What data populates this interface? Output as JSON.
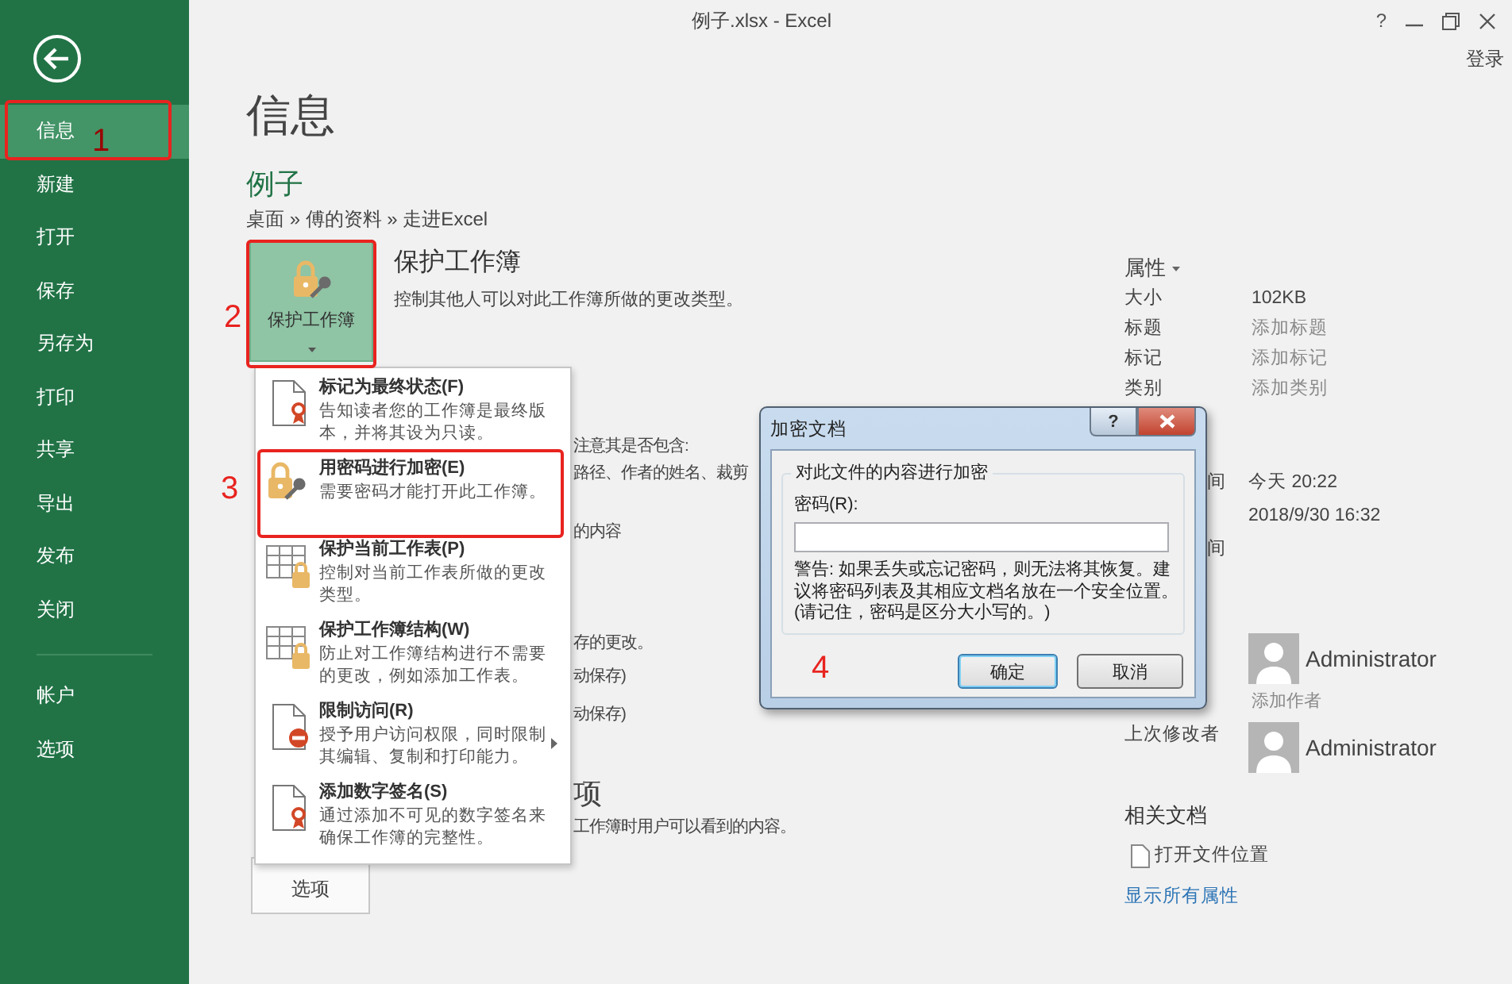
{
  "window": {
    "title": "例子.xlsx - Excel",
    "help": "?",
    "sign_in": "登录"
  },
  "sidebar": {
    "items": [
      {
        "label": "信息",
        "selected": true
      },
      {
        "label": "新建",
        "selected": false
      },
      {
        "label": "打开",
        "selected": false
      },
      {
        "label": "保存",
        "selected": false
      },
      {
        "label": "另存为",
        "selected": false
      },
      {
        "label": "打印",
        "selected": false
      },
      {
        "label": "共享",
        "selected": false
      },
      {
        "label": "导出",
        "selected": false
      },
      {
        "label": "发布",
        "selected": false
      },
      {
        "label": "关闭",
        "selected": false
      }
    ],
    "footer_items": [
      {
        "label": "帐户",
        "selected": false
      },
      {
        "label": "选项",
        "selected": false
      }
    ]
  },
  "page": {
    "heading": "信息",
    "file_name": "例子",
    "path": "桌面 » 傅的资料 » 走进Excel"
  },
  "protect": {
    "button_label": "保护工作簿",
    "title": "保护工作簿",
    "description": "控制其他人可以对此工作簿所做的更改类型。"
  },
  "background_fragments": [
    {
      "kind": "text",
      "text": "注意其是否包含:"
    },
    {
      "kind": "text",
      "text": "路径、作者的姓名、裁剪"
    },
    {
      "kind": "text",
      "text": "的内容"
    },
    {
      "kind": "text",
      "text": "存的更改。"
    },
    {
      "kind": "text",
      "text": "动保存)"
    },
    {
      "kind": "text",
      "text": "动保存)"
    },
    {
      "kind": "heading",
      "text": "项"
    },
    {
      "kind": "text",
      "text": "工作簿时用户可以看到的内容。"
    }
  ],
  "partial_button": {
    "label": "选项"
  },
  "protect_menu": [
    {
      "kind": "final",
      "title": "标记为最终状态(F)",
      "description": "告知读者您的工作簿是最终版本，并将其设为只读。",
      "submenu": false
    },
    {
      "kind": "encrypt",
      "title": "用密码进行加密(E)",
      "description": "需要密码才能打开此工作簿。",
      "submenu": false
    },
    {
      "kind": "sheet",
      "title": "保护当前工作表(P)",
      "description": "控制对当前工作表所做的更改类型。",
      "submenu": false
    },
    {
      "kind": "structure",
      "title": "保护工作簿结构(W)",
      "description": "防止对工作簿结构进行不需要的更改，例如添加工作表。",
      "submenu": false
    },
    {
      "kind": "restrict",
      "title": "限制访问(R)",
      "description": "授予用户访问权限，同时限制其编辑、复制和打印能力。",
      "submenu": true
    },
    {
      "kind": "signature",
      "title": "添加数字签名(S)",
      "description": "通过添加不可见的数字签名来确保工作簿的完整性。",
      "submenu": false
    }
  ],
  "properties": {
    "title": "属性",
    "rows": [
      {
        "label": "大小",
        "value": "102KB",
        "muted": false
      },
      {
        "label": "标题",
        "value": "添加标题",
        "muted": true
      },
      {
        "label": "标记",
        "value": "添加标记",
        "muted": true
      },
      {
        "label": "类别",
        "value": "添加类别",
        "muted": true
      }
    ],
    "dates": [
      {
        "label": "间",
        "value": "今天 20:22"
      },
      {
        "value": "2018/9/30 16:32"
      },
      {
        "label": "间"
      }
    ],
    "author": {
      "name": "Administrator",
      "add": "添加作者"
    },
    "last_modified_by": {
      "label": "上次修改者",
      "name": "Administrator"
    },
    "related": {
      "title": "相关文档",
      "open_location": "打开文件位置"
    },
    "show_all": "显示所有属性"
  },
  "dialog": {
    "title": "加密文档",
    "help": "?",
    "group_title": "对此文件的内容进行加密",
    "password_label": "密码(R):",
    "warning": "警告: 如果丢失或忘记密码，则无法将其恢复。建议将密码列表及其相应文档名放在一个安全位置。(请记住，密码是区分大小写的。)",
    "buttons": [
      {
        "label": "确定",
        "default": true
      },
      {
        "label": "取消",
        "default": false
      }
    ]
  },
  "annotations": [
    {
      "label": "1",
      "framed": true
    },
    {
      "label": "2",
      "framed": true
    },
    {
      "label": "3",
      "framed": true
    },
    {
      "label": "4",
      "framed": false
    }
  ]
}
